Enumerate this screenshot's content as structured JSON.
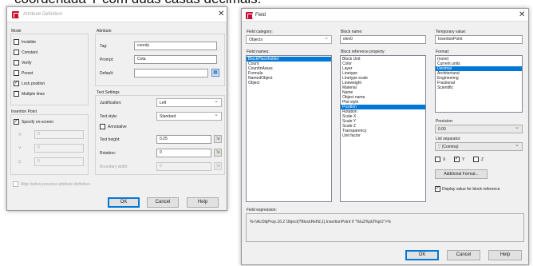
{
  "top_text": "coordenada Y com duas casas decimais.",
  "attdef": {
    "title": "Attribute Definition",
    "mode": {
      "heading": "Mode",
      "items": [
        {
          "label": "Invisible",
          "checked": false
        },
        {
          "label": "Constant",
          "checked": false
        },
        {
          "label": "Verify",
          "checked": false
        },
        {
          "label": "Preset",
          "checked": false
        },
        {
          "label": "Lock position",
          "checked": true
        },
        {
          "label": "Multiple lines",
          "checked": false
        }
      ]
    },
    "attribute": {
      "heading": "Attribute",
      "tag_label": "Tag:",
      "tag_value": "coordy",
      "prompt_label": "Prompt:",
      "prompt_value": "Cota",
      "default_label": "Default:",
      "default_value": ""
    },
    "insertion": {
      "heading": "Insertion Point",
      "specify_label": "Specify on-screen",
      "x_label": "X:",
      "x_value": "0",
      "y_label": "Y:",
      "y_value": "0",
      "z_label": "Z:",
      "z_value": "0"
    },
    "text": {
      "heading": "Text Settings",
      "justification_label": "Justification:",
      "justification_value": "Left",
      "style_label": "Text style:",
      "style_value": "Standard",
      "annotative_label": "Annotative",
      "height_label": "Text height:",
      "height_value": "0.25",
      "rotation_label": "Rotation:",
      "rotation_value": "0",
      "boundary_label": "Boundary width:",
      "boundary_value": "0"
    },
    "align_label": "Align below previous attribute definition",
    "ok": "OK",
    "cancel": "Cancel",
    "help": "Help"
  },
  "field": {
    "title": "Field",
    "category_label": "Field category:",
    "category_value": "Objects",
    "names_label": "Field names:",
    "names": [
      "BlockPlaceholder",
      "Count",
      "CountInAreas",
      "Formula",
      "NamedObject",
      "Object"
    ],
    "names_selected": 0,
    "block_name_label": "Block name:",
    "block_name_value": "elev0",
    "ref_prop_label": "Block reference property:",
    "props": [
      "Block Unit",
      "Color",
      "Layer",
      "Linetype",
      "Linetype scale",
      "Lineweight",
      "Material",
      "Name",
      "Object name",
      "Plot style",
      "Position",
      "Rotation",
      "Scale X",
      "Scale Y",
      "Scale Z",
      "Transparency",
      "Unit factor"
    ],
    "props_selected": 10,
    "temp_label": "Temporary value:",
    "temp_value": "InsertionPoint",
    "format_label": "Format:",
    "formats": [
      "(none)",
      "Current units",
      "Decimal",
      "Architectural",
      "Engineering",
      "Fractional",
      "Scientific"
    ],
    "formats_selected": 2,
    "precision_label": "Precision:",
    "precision_value": "0.00",
    "separator_label": "List separator:",
    "separator_value": "',' (Comma)",
    "axes": [
      {
        "label": "X",
        "checked": false
      },
      {
        "label": "Y",
        "checked": true
      },
      {
        "label": "Z",
        "checked": false
      }
    ],
    "additional_format": "Additional Format...",
    "display_label": "Display value for block reference",
    "expression_label": "Field expression:",
    "expression_value": "%<\\AcObjProp.16.2 Object(?BlockRefId,1).InsertionPoint \\f \"%lu2%pt2%pr2\">%",
    "ok": "OK",
    "cancel": "Cancel",
    "help": "Help"
  }
}
